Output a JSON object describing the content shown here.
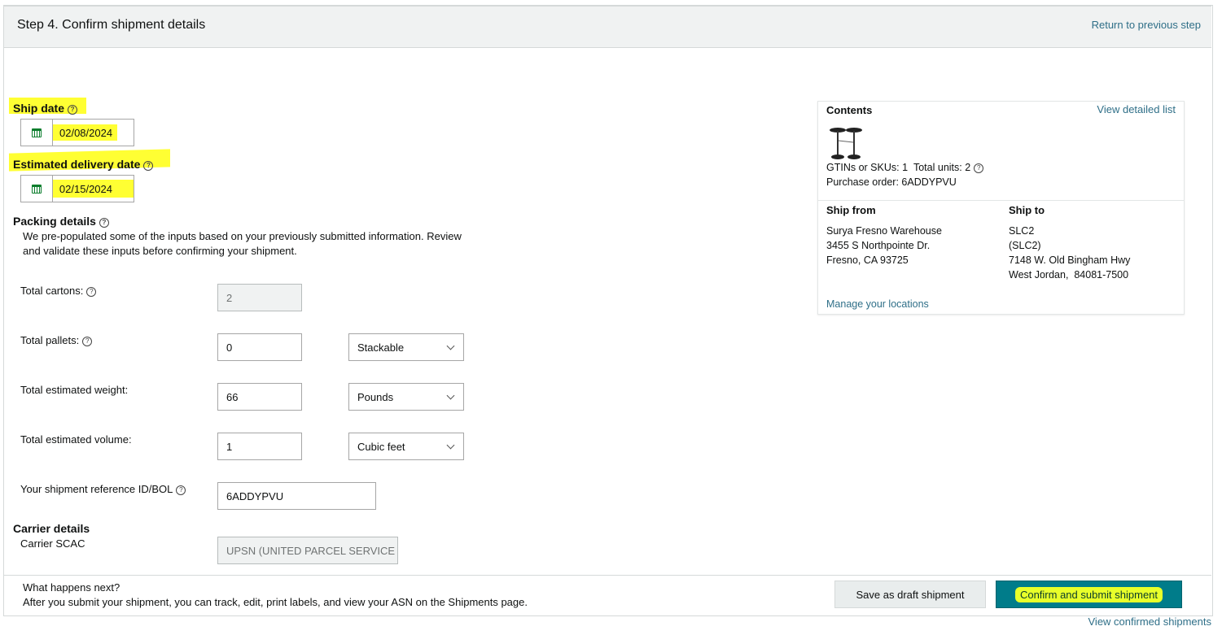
{
  "header": {
    "title": "Step 4. Confirm shipment details",
    "return_link": "Return to previous step"
  },
  "ship_date": {
    "label": "Ship date",
    "value": "02/08/2024"
  },
  "delivery_date": {
    "label": "Estimated delivery date",
    "value": "02/15/2024"
  },
  "packing": {
    "title": "Packing details",
    "description_line1": "We pre-populated some of the inputs based on your previously submitted information. Review",
    "description_line2": "and validate these inputs before confirming your shipment.",
    "cartons": {
      "label": "Total cartons:",
      "value": "2"
    },
    "pallets": {
      "label": "Total pallets:",
      "value": "0",
      "select": "Stackable"
    },
    "weight": {
      "label": "Total estimated weight:",
      "value": "66",
      "select": "Pounds"
    },
    "volume": {
      "label": "Total estimated volume:",
      "value": "1",
      "select": "Cubic feet"
    },
    "reference": {
      "label": "Your shipment reference ID/BOL",
      "value": "6ADDYPVU"
    }
  },
  "carrier": {
    "title": "Carrier details",
    "scac_label": "Carrier SCAC",
    "scac_value": "UPSN (UNITED PARCEL SERVICE IN"
  },
  "contents": {
    "title": "Contents",
    "view_link": "View detailed list",
    "gtins": "GTINs or SKUs: 1",
    "units": "Total units: 2",
    "po": "Purchase order: 6ADDYPVU",
    "ship_from": {
      "title": "Ship from",
      "line1": "Surya Fresno Warehouse",
      "line2": "3455 S Northpointe Dr.",
      "line3": "Fresno, CA 93725"
    },
    "ship_to": {
      "title": "Ship to",
      "line1": "SLC2",
      "line2": "(SLC2)",
      "line3": "7148 W. Old Bingham Hwy",
      "line4": "West Jordan,  84081-7500"
    },
    "manage_link": "Manage your locations"
  },
  "footer": {
    "next_title": "What happens next?",
    "next_text": "After you submit your shipment, you can track, edit, print labels, and view your ASN on the Shipments page.",
    "draft_button": "Save as draft shipment",
    "confirm_button": "Confirm and submit shipment",
    "confirmed_link": "View confirmed shipments"
  },
  "colors": {
    "accent": "#007c8a",
    "link": "#2f6f88",
    "highlight": "#ffff33",
    "calendar": "#0a7d2c"
  }
}
